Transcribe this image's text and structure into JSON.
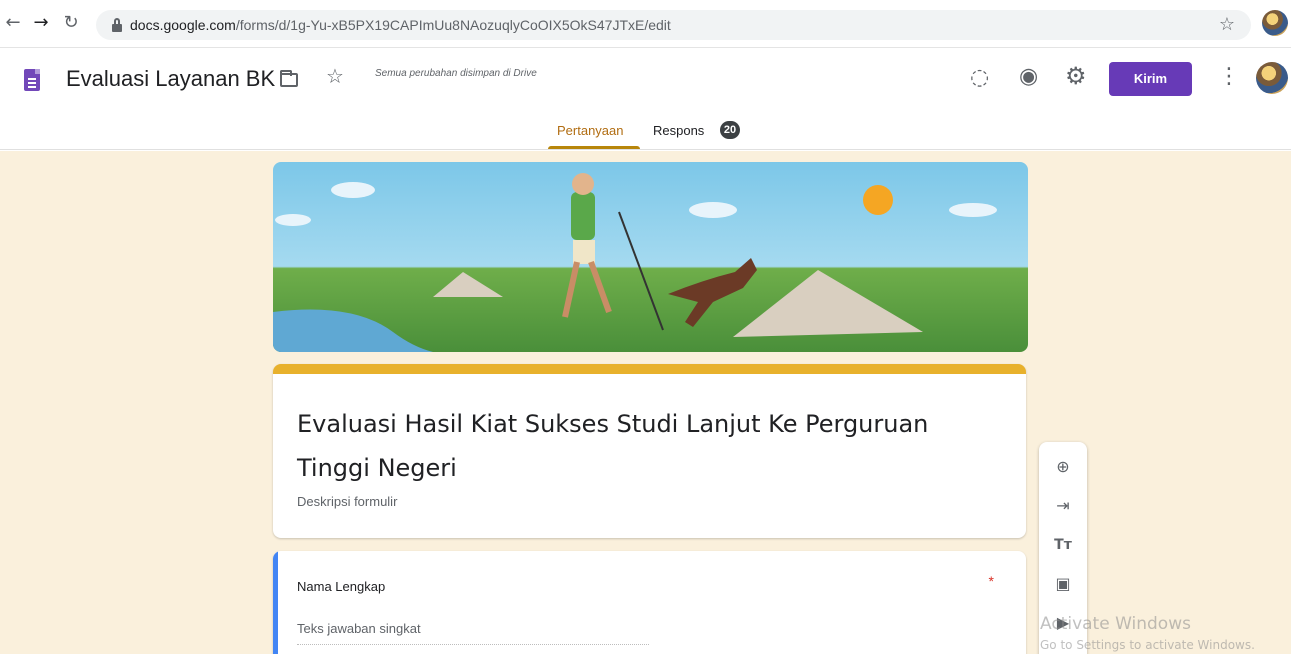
{
  "browser": {
    "url_host": "docs.google.com",
    "url_path": "/forms/d/1g-Yu-xB5PX19CAPImUu8NAozuqlyCoOIX5OkS47JTxE/edit"
  },
  "app": {
    "title": "Evaluasi Layanan BK",
    "save_status": "Semua perubahan disimpan di Drive",
    "send_label": "Kirim",
    "tabs": [
      {
        "label": "Pertanyaan",
        "active": true
      },
      {
        "label": "Respons",
        "count": "20"
      }
    ],
    "icons": [
      "folder-icon",
      "star-icon",
      "palette-icon",
      "eye-icon",
      "settings-icon",
      "more-vert-icon"
    ]
  },
  "form": {
    "title": "Evaluasi Hasil Kiat Sukses Studi Lanjut Ke Perguruan Tinggi Negeri",
    "description_placeholder": "Deskripsi formulir",
    "questions": [
      {
        "label": "Nama Lengkap",
        "required_mark": "*",
        "answer_placeholder": "Teks jawaban singkat"
      }
    ]
  },
  "toolbar": {
    "tools": [
      "add-question-icon",
      "import-questions-icon",
      "add-title-icon",
      "add-image-icon",
      "add-video-icon"
    ]
  },
  "watermark": {
    "line1": "Activate Windows",
    "line2": "Go to Settings to activate Windows."
  },
  "colors": {
    "accent": "#673ab7",
    "theme": "#e8b12c",
    "canvas": "#faf0dc",
    "question_accent": "#4285f4"
  }
}
